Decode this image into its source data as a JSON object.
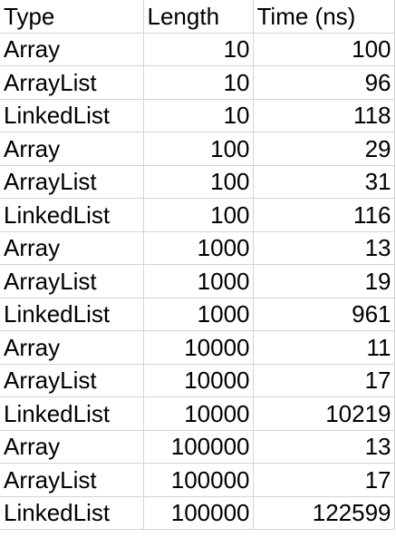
{
  "sheet": {
    "headers": [
      "Type",
      "Length",
      "Time (ns)"
    ],
    "rows": [
      [
        "Array",
        "10",
        "100"
      ],
      [
        "ArrayList",
        "10",
        "96"
      ],
      [
        "LinkedList",
        "10",
        "118"
      ],
      [
        "Array",
        "100",
        "29"
      ],
      [
        "ArrayList",
        "100",
        "31"
      ],
      [
        "LinkedList",
        "100",
        "116"
      ],
      [
        "Array",
        "1000",
        "13"
      ],
      [
        "ArrayList",
        "1000",
        "19"
      ],
      [
        "LinkedList",
        "1000",
        "961"
      ],
      [
        "Array",
        "10000",
        "11"
      ],
      [
        "ArrayList",
        "10000",
        "17"
      ],
      [
        "LinkedList",
        "10000",
        "10219"
      ],
      [
        "Array",
        "100000",
        "13"
      ],
      [
        "ArrayList",
        "100000",
        "17"
      ],
      [
        "LinkedList",
        "100000",
        "122599"
      ]
    ],
    "grid_color": "#d4d4d4"
  }
}
